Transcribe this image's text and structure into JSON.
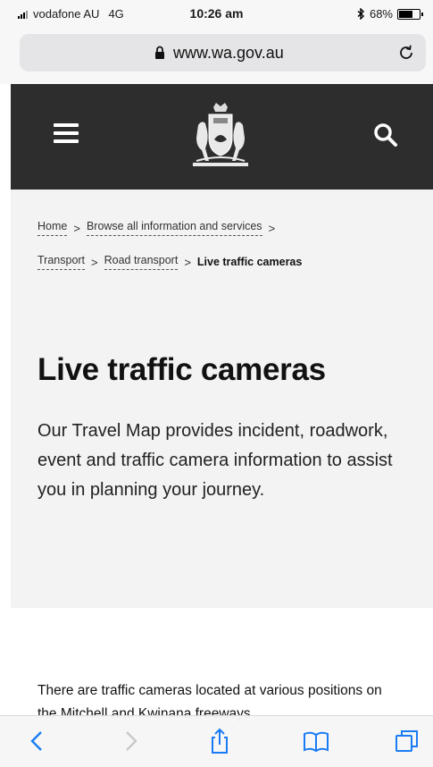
{
  "status_bar": {
    "carrier": "vodafone AU",
    "network": "4G",
    "time": "10:26 am",
    "battery_text": "68%",
    "battery_level": 0.68
  },
  "browser": {
    "url": "www.wa.gov.au",
    "icons": [
      "lock-icon",
      "reload-icon"
    ]
  },
  "header": {
    "icons": [
      "hamburger-menu-icon",
      "wa-government-crest",
      "search-icon"
    ],
    "background": "#2d2d2d"
  },
  "breadcrumb": {
    "items": [
      "Home",
      "Browse all information and services",
      "Transport",
      "Road transport"
    ],
    "current": "Live traffic cameras",
    "separator": ">"
  },
  "page": {
    "title": "Live traffic cameras",
    "intro": "Our Travel Map provides incident, roadwork, event and traffic camera information to assist you in planning your journey.",
    "body": "There are traffic cameras located at various positions on the Mitchell and Kwinana freeways"
  },
  "toolbar": {
    "icons": [
      "back-icon",
      "forward-icon",
      "share-icon",
      "bookmarks-icon",
      "tabs-icon"
    ],
    "accent": "#1a7cf5"
  }
}
